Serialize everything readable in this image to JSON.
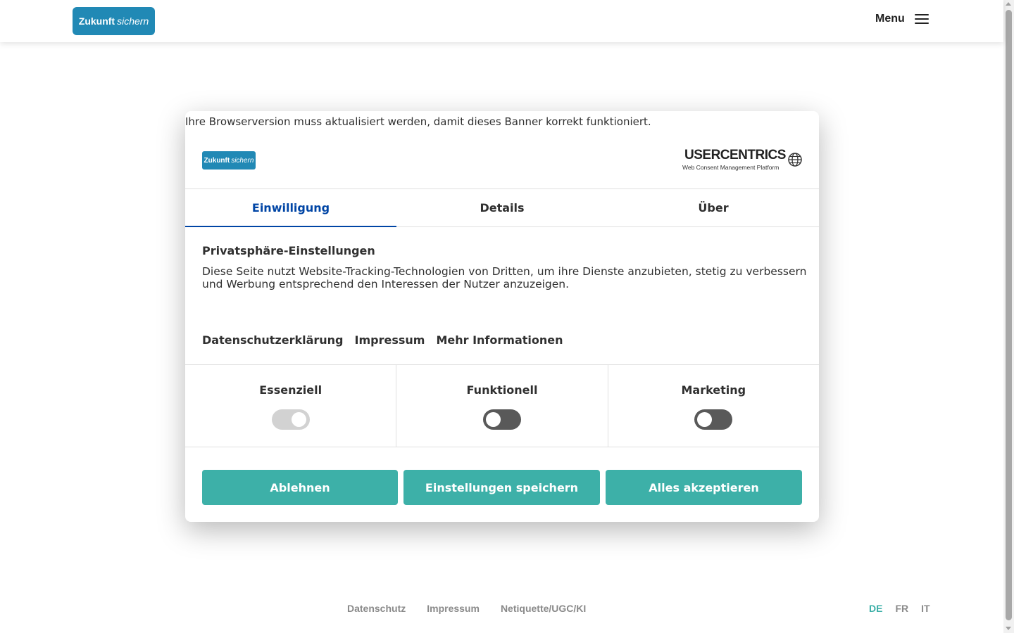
{
  "header": {
    "logo_bold": "Zukunft",
    "logo_italic": "sichern",
    "menu_label": "Menu"
  },
  "footer": {
    "links": [
      "Datenschutz",
      "Impressum",
      "Netiquette/UGC/KI"
    ],
    "languages": [
      "DE",
      "FR",
      "IT"
    ],
    "active_language": "DE"
  },
  "consent": {
    "update_note": "Ihre Browserversion muss aktualisiert werden, damit dieses Banner korrekt funktioniert.",
    "logo_bold": "Zukunft",
    "logo_italic": "sichern",
    "brand_name": "USERCENTRICS",
    "brand_sub": "Web Consent Management Platform",
    "tabs": [
      "Einwilligung",
      "Details",
      "Über"
    ],
    "active_tab": "Einwilligung",
    "title": "Privatsphäre-Einstellungen",
    "text": "Diese Seite nutzt Website-Tracking-Technologien von Dritten, um ihre Dienste anzubieten, stetig zu verbessern und Werbung entsprechend den Interessen der Nutzer anzuzeigen.",
    "links": [
      "Datenschutzerklärung",
      "Impressum",
      "Mehr Informationen"
    ],
    "categories": [
      {
        "label": "Essenziell",
        "state": "on-disabled"
      },
      {
        "label": "Funktionell",
        "state": "off"
      },
      {
        "label": "Marketing",
        "state": "off"
      }
    ],
    "buttons": {
      "deny": "Ablehnen",
      "save": "Einstellungen speichern",
      "accept_all": "Alles akzeptieren"
    }
  },
  "colors": {
    "brand_blue": "#2189b5",
    "accent_teal": "#3db0a8",
    "active_tab_blue": "#0045a5"
  }
}
